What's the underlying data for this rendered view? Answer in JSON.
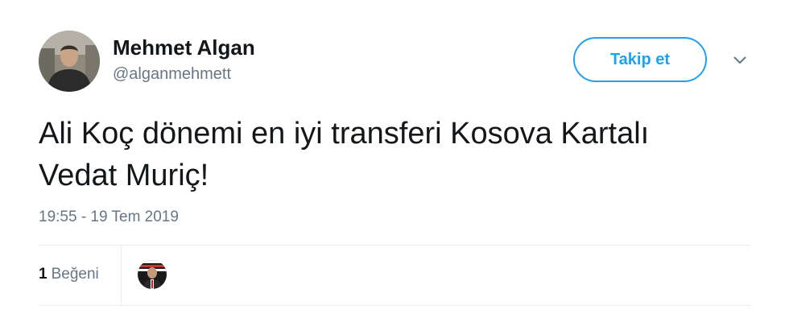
{
  "user": {
    "display_name": "Mehmet Algan",
    "handle": "@alganmehmett",
    "avatar_icon": "user-photo-avatar"
  },
  "header": {
    "follow_label": "Takip et",
    "menu_icon": "chevron-down-icon"
  },
  "tweet": {
    "text": "Ali Koç dönemi en iyi transferi Kosova Kartalı\nVedat Muriç!",
    "timestamp": "19:55 - 19 Tem 2019"
  },
  "stats": {
    "likes_count": "1",
    "likes_label": "Beğeni",
    "liker_avatar_icon": "user-photo-avatar"
  },
  "colors": {
    "accent": "#1da1f2",
    "text_primary": "#14171a",
    "text_secondary": "#657786",
    "divider": "#e6ecf0"
  }
}
